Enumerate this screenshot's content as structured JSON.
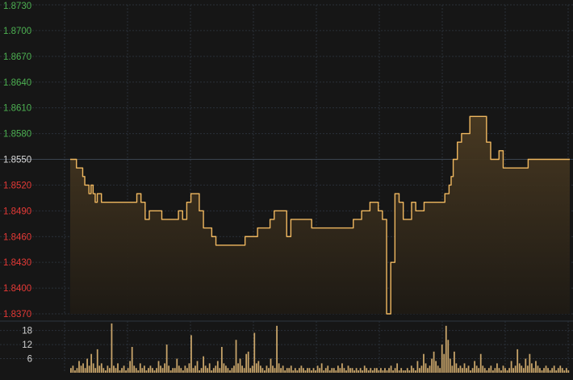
{
  "colors": {
    "background": "#161616",
    "grid": "#2a3038",
    "price_line": "#f0b860",
    "price_fill_top": "#4a3a22",
    "volume_bar": "#c9a56a",
    "up_label": "#4caf50",
    "down_label": "#e53935",
    "ref_label": "#d8d8d8",
    "volume_label": "#d0d0d0"
  },
  "chart_data": [
    {
      "type": "area",
      "name": "intraday-price",
      "reference_price": 1.855,
      "y_ticks": [
        "1.8730",
        "1.8700",
        "1.8670",
        "1.8640",
        "1.8610",
        "1.8580",
        "1.8550",
        "1.8520",
        "1.8490",
        "1.8460",
        "1.8430",
        "1.8400",
        "1.8370"
      ],
      "ylim": [
        1.837,
        1.873
      ],
      "x_range": [
        0,
        240
      ],
      "grid": true,
      "x": [
        0,
        2,
        3,
        5,
        6,
        7,
        8,
        9,
        10,
        11,
        12,
        13,
        14,
        15,
        16,
        18,
        20,
        22,
        24,
        26,
        28,
        30,
        32,
        34,
        36,
        38,
        40,
        42,
        44,
        46,
        48,
        50,
        52,
        54,
        56,
        58,
        60,
        62,
        64,
        66,
        68,
        70,
        72,
        74,
        76,
        78,
        80,
        82,
        84,
        86,
        88,
        90,
        92,
        94,
        96,
        98,
        100,
        102,
        104,
        106,
        108,
        110,
        112,
        114,
        116,
        118,
        120,
        122,
        124,
        126,
        128,
        130,
        132,
        134,
        136,
        138,
        140,
        142,
        144,
        146,
        148,
        150,
        152,
        154,
        156,
        158,
        160,
        162,
        164,
        166,
        168,
        170,
        172,
        174,
        176,
        178,
        180,
        181,
        182,
        183,
        184,
        186,
        188,
        190,
        192,
        194,
        196,
        198,
        200,
        202,
        204,
        206,
        208,
        210,
        212,
        214,
        216,
        218,
        220,
        222,
        224,
        226,
        228,
        230,
        232,
        234,
        236,
        238,
        240
      ],
      "y": [
        1.855,
        1.855,
        1.854,
        1.854,
        1.853,
        1.852,
        1.852,
        1.851,
        1.852,
        1.851,
        1.85,
        1.851,
        1.851,
        1.85,
        1.85,
        1.85,
        1.85,
        1.85,
        1.85,
        1.85,
        1.85,
        1.85,
        1.851,
        1.85,
        1.848,
        1.849,
        1.849,
        1.849,
        1.848,
        1.848,
        1.848,
        1.848,
        1.849,
        1.848,
        1.85,
        1.851,
        1.851,
        1.849,
        1.847,
        1.847,
        1.846,
        1.845,
        1.845,
        1.845,
        1.845,
        1.845,
        1.845,
        1.845,
        1.846,
        1.846,
        1.846,
        1.847,
        1.847,
        1.847,
        1.848,
        1.849,
        1.849,
        1.849,
        1.846,
        1.848,
        1.848,
        1.848,
        1.848,
        1.848,
        1.847,
        1.847,
        1.847,
        1.847,
        1.847,
        1.847,
        1.847,
        1.847,
        1.847,
        1.847,
        1.848,
        1.848,
        1.849,
        1.849,
        1.85,
        1.85,
        1.849,
        1.848,
        1.837,
        1.843,
        1.851,
        1.85,
        1.848,
        1.848,
        1.85,
        1.849,
        1.849,
        1.85,
        1.85,
        1.85,
        1.85,
        1.85,
        1.851,
        1.851,
        1.852,
        1.853,
        1.855,
        1.857,
        1.858,
        1.858,
        1.86,
        1.86,
        1.86,
        1.86,
        1.857,
        1.855,
        1.855,
        1.856,
        1.854,
        1.854,
        1.854,
        1.854,
        1.854,
        1.854,
        1.855,
        1.855,
        1.855,
        1.855,
        1.855,
        1.855,
        1.855,
        1.855,
        1.855,
        1.855,
        1.855
      ]
    },
    {
      "type": "bar",
      "name": "volume",
      "y_ticks": [
        "18",
        "12",
        "6"
      ],
      "ylim": [
        0,
        22
      ],
      "x_range": [
        0,
        240
      ],
      "grid": true,
      "values": [
        2,
        3,
        1,
        2,
        5,
        3,
        4,
        2,
        6,
        3,
        8,
        4,
        2,
        10,
        3,
        4,
        2,
        1,
        3,
        2,
        21,
        3,
        2,
        4,
        1,
        2,
        3,
        1,
        2,
        5,
        11,
        3,
        2,
        1,
        4,
        2,
        3,
        1,
        2,
        3,
        2,
        1,
        2,
        5,
        3,
        2,
        4,
        12,
        3,
        1,
        2,
        2,
        6,
        3,
        2,
        1,
        3,
        2,
        4,
        16,
        2,
        3,
        5,
        1,
        2,
        7,
        3,
        2,
        4,
        1,
        2,
        3,
        5,
        2,
        11,
        4,
        3,
        2,
        1,
        2,
        3,
        14,
        4,
        6,
        3,
        2,
        8,
        9,
        2,
        3,
        17,
        4,
        5,
        3,
        2,
        1,
        3,
        2,
        6,
        3,
        2,
        20,
        4,
        2,
        3,
        1,
        2,
        2,
        3,
        1,
        2,
        1,
        2,
        3,
        2,
        1,
        2,
        2,
        1,
        2,
        1,
        3,
        2,
        4,
        1,
        2,
        3,
        1,
        2,
        2,
        1,
        3,
        2,
        4,
        2,
        1,
        3,
        2,
        2,
        1,
        2,
        1,
        2,
        1,
        3,
        2,
        1,
        2,
        1,
        2,
        2,
        1,
        2,
        1,
        2,
        1,
        2,
        3,
        1,
        2,
        4,
        1,
        2,
        1,
        1,
        2,
        1,
        3,
        2,
        1,
        5,
        2,
        3,
        8,
        4,
        2,
        3,
        6,
        9,
        5,
        3,
        2,
        12,
        8,
        20,
        14,
        6,
        3,
        9,
        4,
        2,
        3,
        2,
        4,
        2,
        3,
        1,
        2,
        5,
        3,
        2,
        8,
        3,
        2,
        1,
        2,
        3,
        1,
        2,
        4,
        2,
        1,
        3,
        2,
        1,
        2,
        5,
        2,
        3,
        10,
        4,
        3,
        2,
        6,
        3,
        8,
        4,
        2,
        5,
        3,
        2,
        1,
        2,
        3,
        2,
        1,
        2,
        3,
        1,
        2,
        3,
        2,
        1,
        2,
        1
      ]
    }
  ]
}
